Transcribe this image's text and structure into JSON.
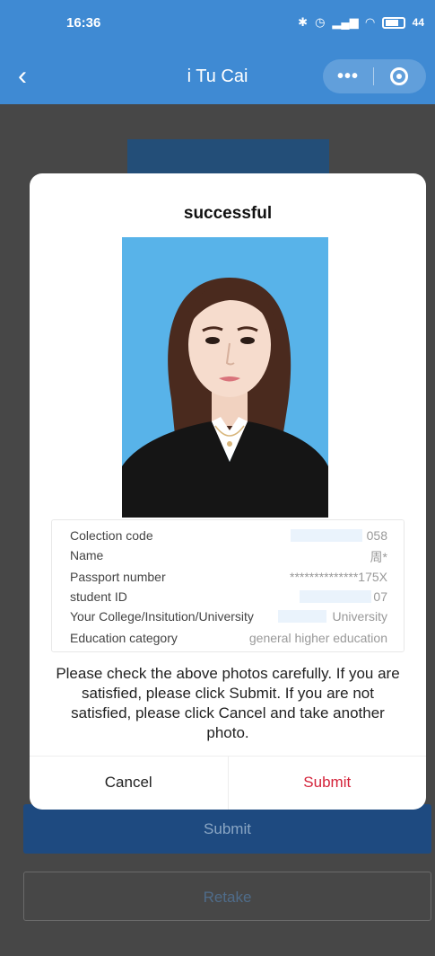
{
  "status_bar": {
    "time": "16:36",
    "battery_pct": "44"
  },
  "nav": {
    "title": "i Tu Cai",
    "more_label": "•••"
  },
  "modal": {
    "title": "successful",
    "info": [
      {
        "label": "Colection code",
        "value": "058"
      },
      {
        "label": "Name",
        "value": "周*"
      },
      {
        "label": "Passport number",
        "value": "**************175X"
      },
      {
        "label": "student ID",
        "value": "07"
      },
      {
        "label": "Your College/Insitution/University",
        "value": "University"
      },
      {
        "label": "Education category",
        "value": "general higher education"
      }
    ],
    "message": "Please check the above photos carefully. If you are satisfied, please click Submit. If you are not satisfied, please click Cancel and take another photo.",
    "cancel_label": "Cancel",
    "submit_label": "Submit"
  },
  "page": {
    "submit_label": "Submit",
    "retake_label": "Retake"
  }
}
